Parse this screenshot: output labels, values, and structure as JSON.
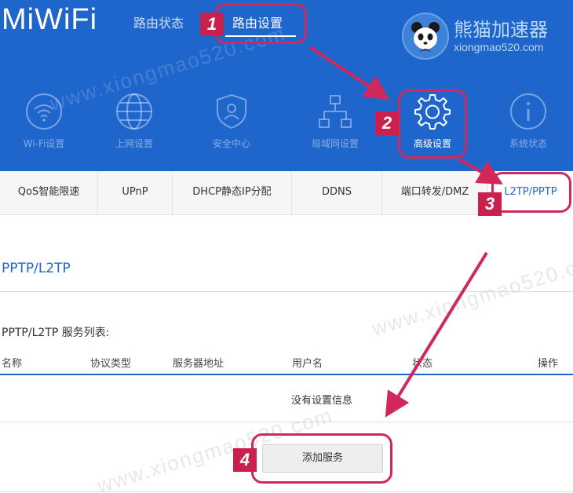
{
  "header": {
    "logo": "MiWiFi",
    "tabs": [
      {
        "label": "路由状态"
      },
      {
        "label": "路由设置"
      }
    ],
    "brand": {
      "name": "熊猫加速器",
      "url": "xiongmao520.com"
    }
  },
  "icon_nav": [
    {
      "label": "Wi-Fi设置",
      "icon": "wifi-icon"
    },
    {
      "label": "上网设置",
      "icon": "globe-icon"
    },
    {
      "label": "安全中心",
      "icon": "shield-icon"
    },
    {
      "label": "局域网设置",
      "icon": "lan-icon"
    },
    {
      "label": "高级设置",
      "icon": "gear-icon"
    },
    {
      "label": "系统状态",
      "icon": "info-icon"
    }
  ],
  "subtabs": [
    {
      "label": "QoS智能限速"
    },
    {
      "label": "UPnP"
    },
    {
      "label": "DHCP静态IP分配"
    },
    {
      "label": "DDNS"
    },
    {
      "label": "端口转发/DMZ"
    },
    {
      "label": "L2TP/PPTP"
    }
  ],
  "content": {
    "section_title": "PPTP/L2TP",
    "list_title": "PPTP/L2TP 服务列表:",
    "columns": [
      "名称",
      "协议类型",
      "服务器地址",
      "用户名",
      "状态",
      "操作"
    ],
    "empty_text": "没有设置信息",
    "add_button": "添加服务"
  },
  "watermark": "www.xiongmao520.com",
  "annotations": [
    {
      "step": "1"
    },
    {
      "step": "2"
    },
    {
      "step": "3"
    },
    {
      "step": "4"
    }
  ],
  "colors": {
    "header_blue": "#1f66cc",
    "active_tab_text": "#1f66cc",
    "annotation": "#d1285c"
  }
}
